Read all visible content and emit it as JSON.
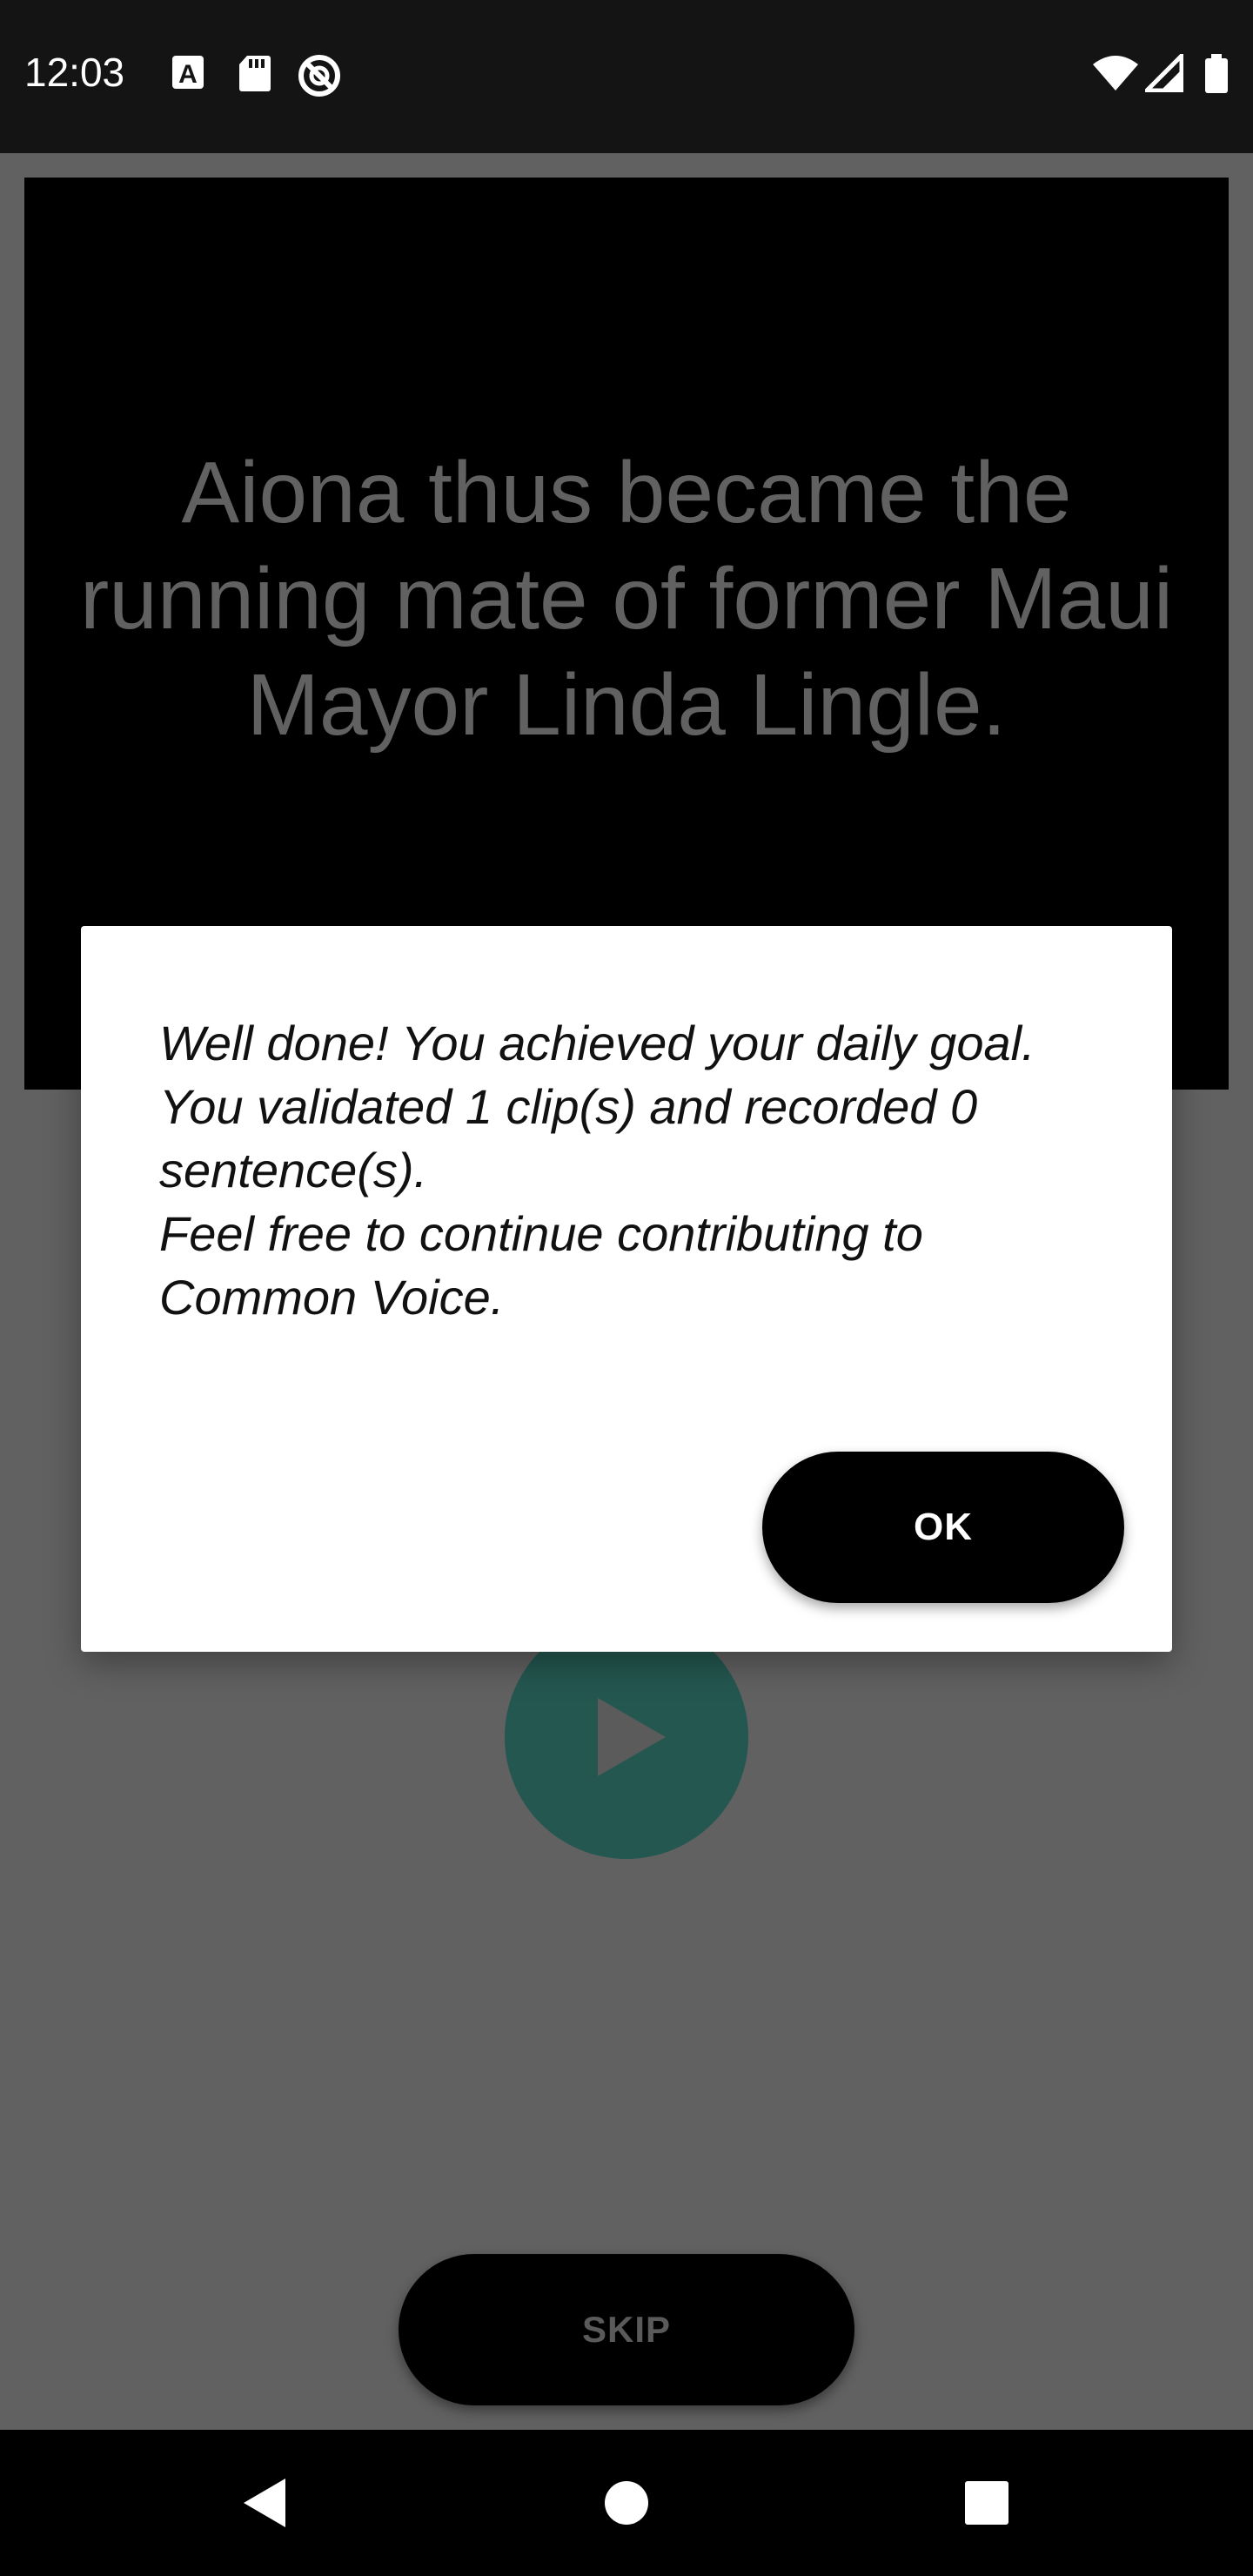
{
  "status_bar": {
    "time": "12:03",
    "left_icons": [
      "font-a-icon",
      "sd-card-icon",
      "do-not-disturb-icon"
    ],
    "right_icons": [
      "wifi-icon",
      "cell-signal-icon",
      "battery-icon"
    ]
  },
  "sentence": {
    "text": "Aiona thus became the running mate of former Maui Mayor Linda Lingle."
  },
  "player": {
    "icon": "play-icon"
  },
  "skip": {
    "label": "SKIP"
  },
  "dialog": {
    "line1": "Well done! You achieved your daily goal.",
    "line2": "You validated 1 clip(s) and recorded 0 sentence(s).",
    "line3": "Feel free to continue contributing to Common Voice.",
    "ok_label": "OK"
  },
  "nav_bar": {
    "buttons": [
      "back-icon",
      "home-icon",
      "recents-icon"
    ]
  },
  "colors": {
    "scrim": "#616161",
    "play_button": "#245750",
    "dialog_bg": "#ffffff",
    "button_bg": "#000000"
  }
}
